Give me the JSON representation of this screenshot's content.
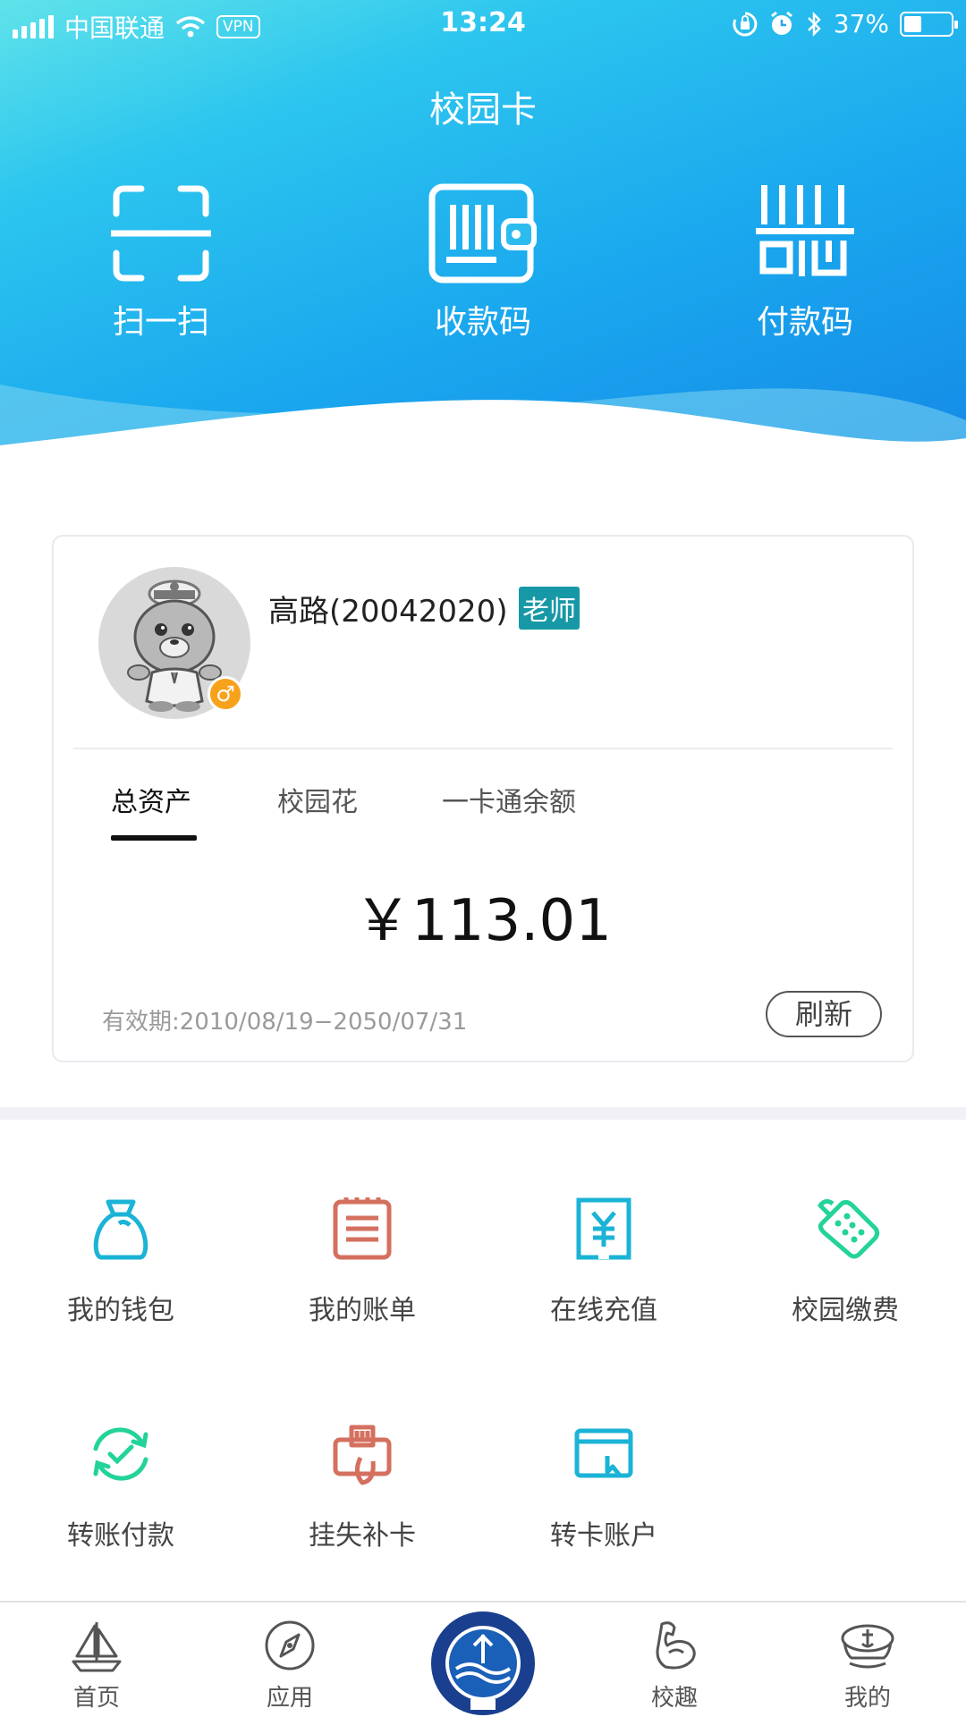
{
  "status_bar": {
    "carrier": "中国联通",
    "vpn": "VPN",
    "time": "13:24",
    "battery_text": "37%",
    "battery_level": 0.37
  },
  "header": {
    "title": "校园卡",
    "actions": [
      {
        "label": "扫一扫",
        "icon": "scan-icon"
      },
      {
        "label": "收款码",
        "icon": "receive-code-icon"
      },
      {
        "label": "付款码",
        "icon": "pay-code-icon"
      }
    ]
  },
  "card": {
    "user_name": "高路(20042020)",
    "role": "老师",
    "gender_symbol": "♂",
    "tabs": [
      "总资产",
      "校园花",
      "一卡通余额"
    ],
    "active_tab": "总资产",
    "amount": "￥113.01",
    "validity": "有效期:2010/08/19−2050/07/31",
    "refresh_label": "刷新"
  },
  "services": [
    {
      "label": "我的钱包",
      "icon": "wallet-bag-icon",
      "color": "#1bb3d6"
    },
    {
      "label": "我的账单",
      "icon": "bill-icon",
      "color": "#d4705f"
    },
    {
      "label": "在线充值",
      "icon": "yuan-recharge-icon",
      "color": "#1bb3d6"
    },
    {
      "label": "校园缴费",
      "icon": "payment-terminal-icon",
      "color": "#23d39a"
    },
    {
      "label": "转账付款",
      "icon": "transfer-cycle-icon",
      "color": "#23d39a"
    },
    {
      "label": "挂失补卡",
      "icon": "card-report-icon",
      "color": "#d4705f"
    },
    {
      "label": "转卡账户",
      "icon": "card-account-icon",
      "color": "#1bb3d6"
    }
  ],
  "nav": [
    {
      "label": "首页",
      "icon": "sailboat-icon"
    },
    {
      "label": "应用",
      "icon": "compass-icon"
    },
    {
      "label": "",
      "icon": "university-logo-icon"
    },
    {
      "label": "校趣",
      "icon": "muscle-arm-icon"
    },
    {
      "label": "我的",
      "icon": "captain-hat-icon"
    }
  ]
}
